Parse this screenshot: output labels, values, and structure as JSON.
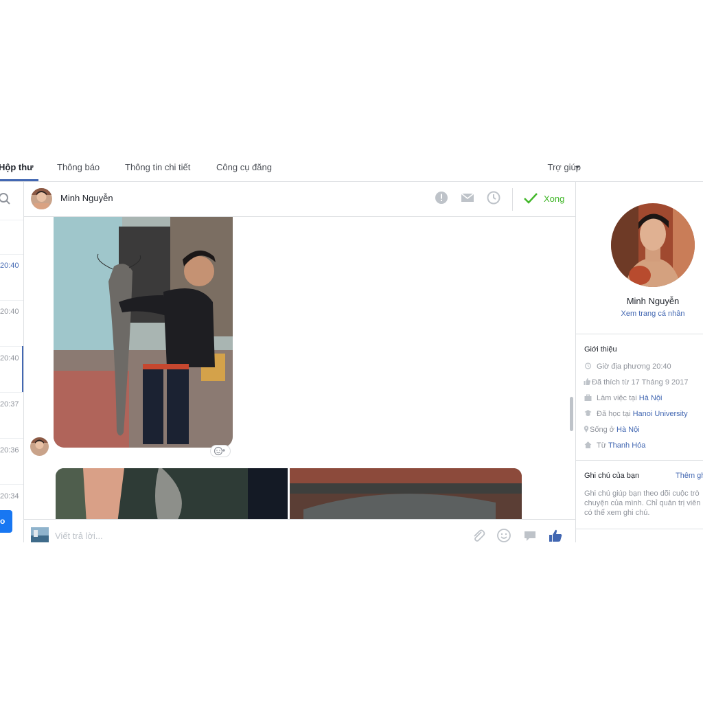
{
  "nav": {
    "tabs": [
      {
        "label": "Hộp thư",
        "active": true
      },
      {
        "label": "Thông báo"
      },
      {
        "label": "Thông tin chi tiết"
      },
      {
        "label": "Công cụ đăng"
      }
    ],
    "help_label": "Trợ giúp"
  },
  "inbox": {
    "times": [
      {
        "label": "20:40",
        "unread": true
      },
      {
        "label": "20:40"
      },
      {
        "label": "20:40",
        "selected": true
      },
      {
        "label": "20:37"
      },
      {
        "label": "20:36"
      },
      {
        "label": "20:34"
      }
    ],
    "button_label": "o"
  },
  "conversation": {
    "contact_name": "Minh Nguyễn",
    "done_label": "Xong",
    "header_icons": [
      "alert-icon",
      "mail-icon",
      "clock-icon"
    ],
    "composer_placeholder": "Viết trả lời...",
    "composer_icons": [
      "attach-icon",
      "emoji-icon",
      "sticker-icon",
      "like-icon"
    ]
  },
  "profile": {
    "name": "Minh Nguyễn",
    "view_profile": "Xem trang cá nhân",
    "about_title": "Giới thiệu",
    "local_time": "Giờ địa phương 20:40",
    "liked_since": "Đã thích từ 17 Tháng 9 2017",
    "work_prefix": "Làm việc tại",
    "work_place": "Hà Nội",
    "study_prefix": "Đã học tại",
    "study_place": "Hanoi University",
    "lives_prefix": "Sống ở",
    "lives_place": "Hà Nội",
    "from_prefix": "Từ",
    "from_place": "Thanh Hóa",
    "notes_title": "Ghi chú của bạn",
    "notes_add": "Thêm gh",
    "notes_text": "Ghi chú giúp bạn theo dõi cuộc trò chuyện của mình. Chỉ quản trị viên có thể xem ghi chú."
  },
  "colors": {
    "accent": "#4267b2",
    "done": "#42b72a",
    "muted": "#90949c",
    "border": "#dddfe2"
  }
}
